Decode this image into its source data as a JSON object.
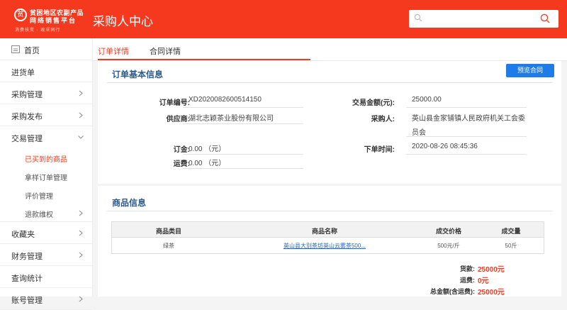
{
  "header": {
    "logo_emblem": "贫",
    "logo_line1": "贫困地区农副产品",
    "logo_line2": "网络销售平台",
    "logo_tagline": "消费扶贫 · 政采同行",
    "title": "采购人中心",
    "search_placeholder": ""
  },
  "sidebar": {
    "home": "首页",
    "inbound": "进货单",
    "purchase_mgmt": "采购管理",
    "purchase_publish": "采购发布",
    "trade_mgmt": "交易管理",
    "trade_sub": {
      "bought": "已买到的商品",
      "sample_orders": "拿样订单管理",
      "reviews": "评价管理",
      "refunds": "退款维权"
    },
    "favorites": "收藏夹",
    "finance": "财务管理",
    "stats": "查询统计",
    "more": "账号管理"
  },
  "tabs": {
    "order_detail": "订单详情",
    "contract_detail": "合同详情"
  },
  "order_info": {
    "title": "订单基本信息",
    "preview_button": "预览合同",
    "order_no_label": "订单编号:",
    "order_no": "XD2020082600514150",
    "amount_label": "交易金额(元):",
    "amount": "25000.00",
    "supplier_label": "供应商:",
    "supplier": "湖北志颖茶业股份有限公司",
    "buyer_label": "采购人:",
    "buyer_line1": "英山县金家铺镇人民政府机关工会委",
    "buyer_line2": "员会",
    "deposit_label": "订金:",
    "deposit": "0.00 （元）",
    "shipping_label": "运费:",
    "shipping": "0.00 （元）",
    "order_time_label": "下单时间:",
    "order_time": "2020-08-26 08:45:36"
  },
  "goods": {
    "title": "商品信息",
    "headers": {
      "category": "商品类目",
      "name": "商品名称",
      "price": "成交价格",
      "qty": "成交量"
    },
    "rows": [
      {
        "category": "绿茶",
        "name": "英山县大别茶坊英山云雾茶500...",
        "price": "500元/斤",
        "qty": "50斤"
      }
    ],
    "totals": {
      "goods_label": "货款:",
      "goods_value": "25000元",
      "shipping_label": "运费:",
      "shipping_value": "0元",
      "total_label": "总金额(含运费):",
      "total_value": "25000元"
    }
  },
  "colors": {
    "brand": "#f5391f",
    "title_blue": "#2d5a8c",
    "button_blue": "#1e7ce8"
  }
}
